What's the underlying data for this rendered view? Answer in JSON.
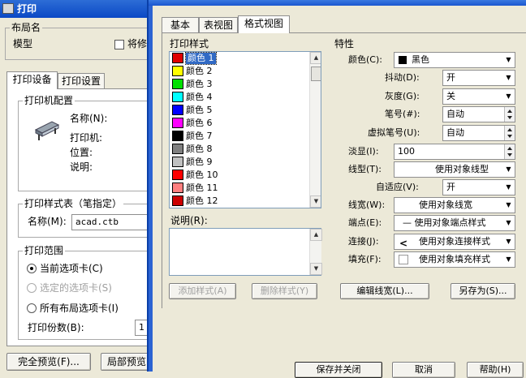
{
  "plot_dialog": {
    "title": "打印",
    "layout_group": {
      "label": "布局名",
      "name": "模型",
      "save_changes": "将修"
    },
    "tabs": [
      "打印设备",
      "打印设置"
    ],
    "plotter": {
      "label": "打印机配置",
      "name_label": "名称(N):",
      "plotter_label": "打印机:",
      "location_label": "位置:",
      "description_label": "说明:"
    },
    "plot_style_table": {
      "label": "打印样式表（笔指定）",
      "name_label": "名称(M):",
      "name_value": "acad.ctb"
    },
    "plot_range": {
      "label": "打印范围",
      "options": [
        "当前选项卡(C)",
        "选定的选项卡(S)",
        "所有布局选项卡(I)"
      ],
      "copies_label": "打印份数(B):",
      "copies_value": "1"
    },
    "buttons": {
      "full_preview": "完全预览(F)...",
      "partial_preview": "局部预览"
    }
  },
  "editor": {
    "tabs": [
      "基本",
      "表视图",
      "格式视图"
    ],
    "styles": {
      "label": "打印样式",
      "items": [
        {
          "label": "颜色 1",
          "color": "#e00000"
        },
        {
          "label": "颜色 2",
          "color": "#ffff00"
        },
        {
          "label": "颜色 3",
          "color": "#00e000"
        },
        {
          "label": "颜色 4",
          "color": "#00ffff"
        },
        {
          "label": "颜色 5",
          "color": "#0000ff"
        },
        {
          "label": "颜色 6",
          "color": "#ff00ff"
        },
        {
          "label": "颜色 7",
          "color": "#000000"
        },
        {
          "label": "颜色 8",
          "color": "#808080"
        },
        {
          "label": "颜色 9",
          "color": "#c0c0c0"
        },
        {
          "label": "颜色 10",
          "color": "#ff0000"
        },
        {
          "label": "颜色 11",
          "color": "#ff7f7f"
        },
        {
          "label": "颜色 12",
          "color": "#cc0000"
        }
      ]
    },
    "description_label": "说明(R):",
    "properties": {
      "label": "特性",
      "color_label": "颜色(C):",
      "color_value": "黑色",
      "dither_label": "抖动(D):",
      "dither_value": "开",
      "grayscale_label": "灰度(G):",
      "grayscale_value": "关",
      "pen_label": "笔号(#):",
      "pen_value": "自动",
      "virtual_pen_label": "虚拟笔号(U):",
      "virtual_pen_value": "自动",
      "screening_label": "淡显(I):",
      "screening_value": "100",
      "linetype_label": "线型(T):",
      "linetype_value": "使用对象线型",
      "adaptive_label": "自适应(V):",
      "adaptive_value": "开",
      "lineweight_label": "线宽(W):",
      "lineweight_value": "使用对象线宽",
      "endstyle_label": "端点(E):",
      "endstyle_value": "— 使用对象端点样式",
      "joinstyle_label": "连接(J):",
      "joinstyle_value": "使用对象连接样式",
      "fillstyle_label": "填充(F):",
      "fillstyle_value": "使用对象填充样式"
    },
    "buttons": {
      "add_style": "添加样式(A)",
      "delete_style": "删除样式(Y)",
      "edit_lineweights": "编辑线宽(L)...",
      "save_as": "另存为(S)...",
      "save_close": "保存并关闭",
      "cancel": "取消",
      "help": "帮助(H)"
    }
  }
}
